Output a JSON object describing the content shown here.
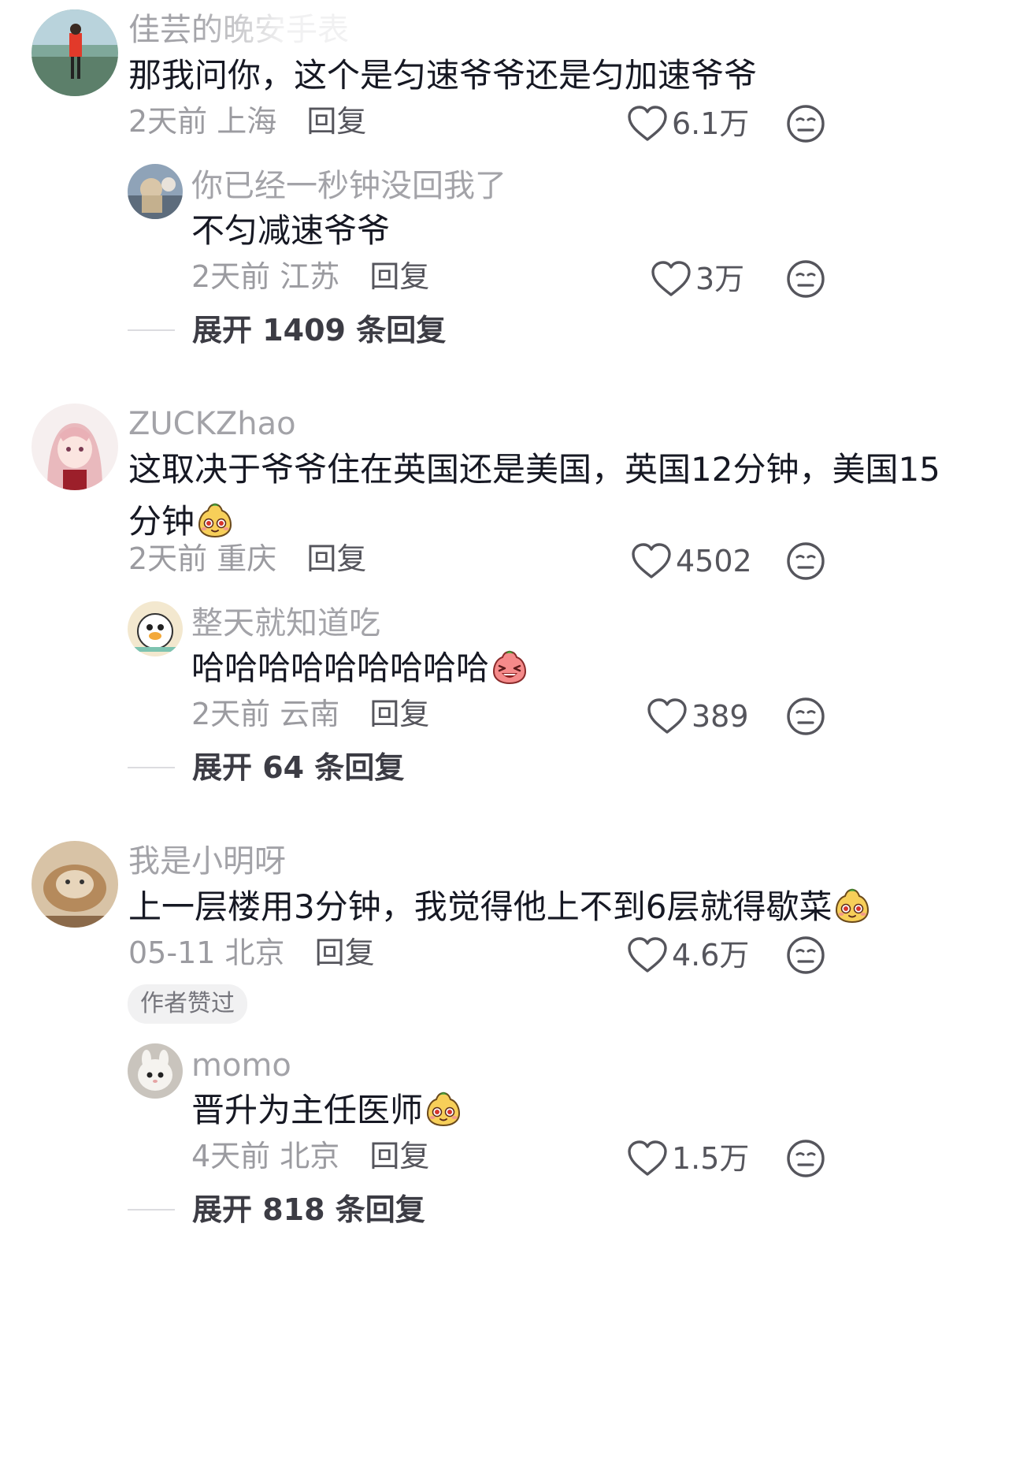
{
  "comments": [
    {
      "user": "佳芸的晚安手表",
      "text": "那我问你，这个是匀速爷爷还是匀加速爷爷",
      "time": "2天前",
      "location": "上海",
      "reply_label": "回复",
      "likes": "6.1万",
      "reply": {
        "user": "你已经一秒钟没回我了",
        "text": "不匀减速爷爷",
        "time": "2天前",
        "location": "江苏",
        "reply_label": "回复",
        "likes": "3万"
      },
      "expand": "展开 1409 条回复"
    },
    {
      "user": "ZUCKZhao",
      "text": "这取决于爷爷住在英国还是美国，英国12分钟，美国15分钟",
      "emoji": "smug-face-emoji",
      "time": "2天前",
      "location": "重庆",
      "reply_label": "回复",
      "likes": "4502",
      "reply": {
        "user": "整天就知道吃",
        "text": "哈哈哈哈哈哈哈哈哈",
        "emoji": "laughing-face-emoji",
        "time": "2天前",
        "location": "云南",
        "reply_label": "回复",
        "likes": "389"
      },
      "expand": "展开 64 条回复"
    },
    {
      "user": "我是小明呀",
      "text": "上一层楼用3分钟，我觉得他上不到6层就得歇菜",
      "emoji": "smug-face-emoji",
      "time": "05-11",
      "location": "北京",
      "reply_label": "回复",
      "likes": "4.6万",
      "badge": "作者赞过",
      "reply": {
        "user": "momo",
        "text": "晋升为主任医师",
        "emoji": "smug-face-emoji",
        "time": "4天前",
        "location": "北京",
        "reply_label": "回复",
        "likes": "1.5万"
      },
      "expand": "展开 818 条回复"
    }
  ],
  "colors": {
    "text": "#161823",
    "secondary": "#9b9ba0",
    "username": "#a3a3a8",
    "expand": "#3c3c44"
  }
}
